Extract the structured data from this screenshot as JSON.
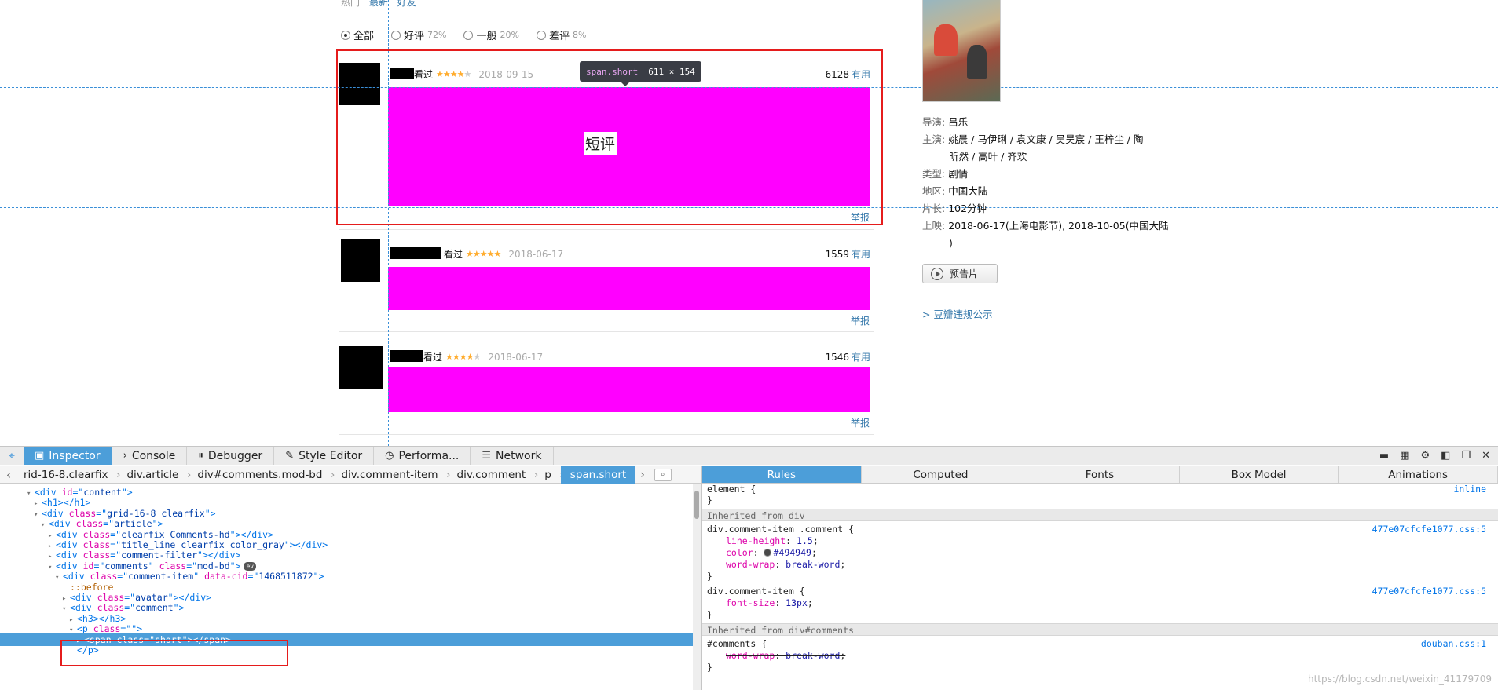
{
  "page": {
    "top_links": {
      "hot": "热门",
      "latest": "最新",
      "friends": "好友"
    },
    "filter": [
      {
        "label": "全部",
        "pct": "",
        "checked": true
      },
      {
        "label": "好评",
        "pct": "72%",
        "checked": false
      },
      {
        "label": "一般",
        "pct": "20%",
        "checked": false
      },
      {
        "label": "差评",
        "pct": "8%",
        "checked": false
      }
    ],
    "comments": [
      {
        "status": "看过",
        "stars": 4,
        "date": "2018-09-15",
        "votes": "6128",
        "useful": "有用",
        "report": "举报"
      },
      {
        "status": "看过",
        "stars": 5,
        "date": "2018-06-17",
        "votes": "1559",
        "useful": "有用",
        "report": "举报"
      },
      {
        "status": "看过",
        "stars": 4,
        "date": "2018-06-17",
        "votes": "1546",
        "useful": "有用",
        "report": "举报"
      }
    ],
    "short_label": "短评",
    "tooltip": {
      "tag": "span.short",
      "dims": "611 × 154"
    },
    "movie": [
      {
        "key": "导演:",
        "value": "吕乐"
      },
      {
        "key": "主演:",
        "value": "姚晨 / 马伊琍 / 袁文康 / 吴昊宸 / 王梓尘 / 陶"
      },
      {
        "key": "",
        "value": "昕然 / 高叶 / 齐欢"
      },
      {
        "key": "类型:",
        "value": "剧情"
      },
      {
        "key": "地区:",
        "value": "中国大陆"
      },
      {
        "key": "片长:",
        "value": "102分钟"
      },
      {
        "key": "上映:",
        "value": "2018-06-17(上海电影节), 2018-10-05(中国大陆"
      },
      {
        "key": "",
        "value": ")"
      }
    ],
    "trailer": "预告片",
    "violation": "> 豆瓣违规公示"
  },
  "devtools": {
    "tabs": [
      "Inspector",
      "Console",
      "Debugger",
      "Style Editor",
      "Performa...",
      "Network"
    ],
    "breadcrumbs": [
      "rid-16-8.clearfix",
      "div.article",
      "div#comments.mod-bd",
      "div.comment-item",
      "div.comment",
      "p",
      "span.short"
    ],
    "side_tabs": [
      "Rules",
      "Computed",
      "Fonts",
      "Box Model",
      "Animations"
    ],
    "markup": [
      {
        "indent": 2,
        "twisty": "▾",
        "html": [
          [
            "t",
            "<div "
          ],
          [
            "a",
            "id"
          ],
          [
            "t",
            "=\""
          ],
          [
            "v",
            "content"
          ],
          [
            "t",
            "\">"
          ]
        ]
      },
      {
        "indent": 3,
        "twisty": "▸",
        "html": [
          [
            "t",
            "<h1></h1>"
          ]
        ]
      },
      {
        "indent": 3,
        "twisty": "▾",
        "html": [
          [
            "t",
            "<div "
          ],
          [
            "a",
            "class"
          ],
          [
            "t",
            "=\""
          ],
          [
            "v",
            "grid-16-8 clearfix"
          ],
          [
            "t",
            "\">"
          ]
        ]
      },
      {
        "indent": 4,
        "twisty": "▾",
        "html": [
          [
            "t",
            "<div "
          ],
          [
            "a",
            "class"
          ],
          [
            "t",
            "=\""
          ],
          [
            "v",
            "article"
          ],
          [
            "t",
            "\">"
          ]
        ]
      },
      {
        "indent": 5,
        "twisty": "▸",
        "html": [
          [
            "t",
            "<div "
          ],
          [
            "a",
            "class"
          ],
          [
            "t",
            "=\""
          ],
          [
            "v",
            "clearfix Comments-hd"
          ],
          [
            "t",
            "\"></div>"
          ]
        ]
      },
      {
        "indent": 5,
        "twisty": "▸",
        "html": [
          [
            "t",
            "<div "
          ],
          [
            "a",
            "class"
          ],
          [
            "t",
            "=\""
          ],
          [
            "v",
            "title_line clearfix color_gray"
          ],
          [
            "t",
            "\"></div>"
          ]
        ]
      },
      {
        "indent": 5,
        "twisty": "▸",
        "html": [
          [
            "t",
            "<div "
          ],
          [
            "a",
            "class"
          ],
          [
            "t",
            "=\""
          ],
          [
            "v",
            "comment-filter"
          ],
          [
            "t",
            "\"></div>"
          ]
        ]
      },
      {
        "indent": 5,
        "twisty": "▾",
        "html": [
          [
            "t",
            "<div "
          ],
          [
            "a",
            "id"
          ],
          [
            "t",
            "=\""
          ],
          [
            "v",
            "comments"
          ],
          [
            "t",
            "\" "
          ],
          [
            "a",
            "class"
          ],
          [
            "t",
            "=\""
          ],
          [
            "v",
            "mod-bd"
          ],
          [
            "t",
            "\">"
          ]
        ],
        "badge": "ev"
      },
      {
        "indent": 6,
        "twisty": "▾",
        "html": [
          [
            "t",
            "<div "
          ],
          [
            "a",
            "class"
          ],
          [
            "t",
            "=\""
          ],
          [
            "v",
            "comment-item"
          ],
          [
            "t",
            "\" "
          ],
          [
            "a",
            "data-cid"
          ],
          [
            "t",
            "=\""
          ],
          [
            "v",
            "1468511872"
          ],
          [
            "t",
            "\">"
          ]
        ]
      },
      {
        "indent": 7,
        "twisty": "",
        "html": [
          [
            "p",
            "::before"
          ]
        ]
      },
      {
        "indent": 7,
        "twisty": "▸",
        "html": [
          [
            "t",
            "<div "
          ],
          [
            "a",
            "class"
          ],
          [
            "t",
            "=\""
          ],
          [
            "v",
            "avatar"
          ],
          [
            "t",
            "\"></div>"
          ]
        ]
      },
      {
        "indent": 7,
        "twisty": "▾",
        "html": [
          [
            "t",
            "<div "
          ],
          [
            "a",
            "class"
          ],
          [
            "t",
            "=\""
          ],
          [
            "v",
            "comment"
          ],
          [
            "t",
            "\">"
          ]
        ]
      },
      {
        "indent": 8,
        "twisty": "▸",
        "html": [
          [
            "t",
            "<h3></h3>"
          ]
        ]
      },
      {
        "indent": 8,
        "twisty": "▾",
        "html": [
          [
            "t",
            "<p "
          ],
          [
            "a",
            "class"
          ],
          [
            "t",
            "=\"\">"
          ]
        ]
      },
      {
        "indent": 9,
        "twisty": "▸",
        "html": [
          [
            "t",
            "<span "
          ],
          [
            "a",
            "class"
          ],
          [
            "t",
            "=\""
          ],
          [
            "v",
            "short"
          ],
          [
            "t",
            "\"></span>"
          ]
        ],
        "selected": true
      },
      {
        "indent": 8,
        "twisty": "",
        "html": [
          [
            "t",
            "</p>"
          ]
        ]
      }
    ],
    "rules": {
      "element": {
        "selector": "element {",
        "source": "inline"
      },
      "inherited_div": "Inherited from div",
      "rule1": {
        "selector": "div.comment-item .comment {",
        "source": "477e07cfcfe1077.css:5",
        "props": [
          {
            "name": "line-height",
            "value": "1.5"
          },
          {
            "name": "color",
            "value": "#494949",
            "swatch": true
          },
          {
            "name": "word-wrap",
            "value": "break-word"
          }
        ]
      },
      "rule2": {
        "selector": "div.comment-item {",
        "source": "477e07cfcfe1077.css:5",
        "props": [
          {
            "name": "font-size",
            "value": "13px"
          }
        ]
      },
      "inherited_comments": "Inherited from div#comments",
      "rule3": {
        "selector": "#comments {",
        "source": "douban.css:1",
        "props": [
          {
            "name": "word-wrap",
            "value": "break-word",
            "strike": true
          }
        ]
      },
      "close": "}"
    },
    "watermark": "https://blog.csdn.net/weixin_41179709"
  }
}
